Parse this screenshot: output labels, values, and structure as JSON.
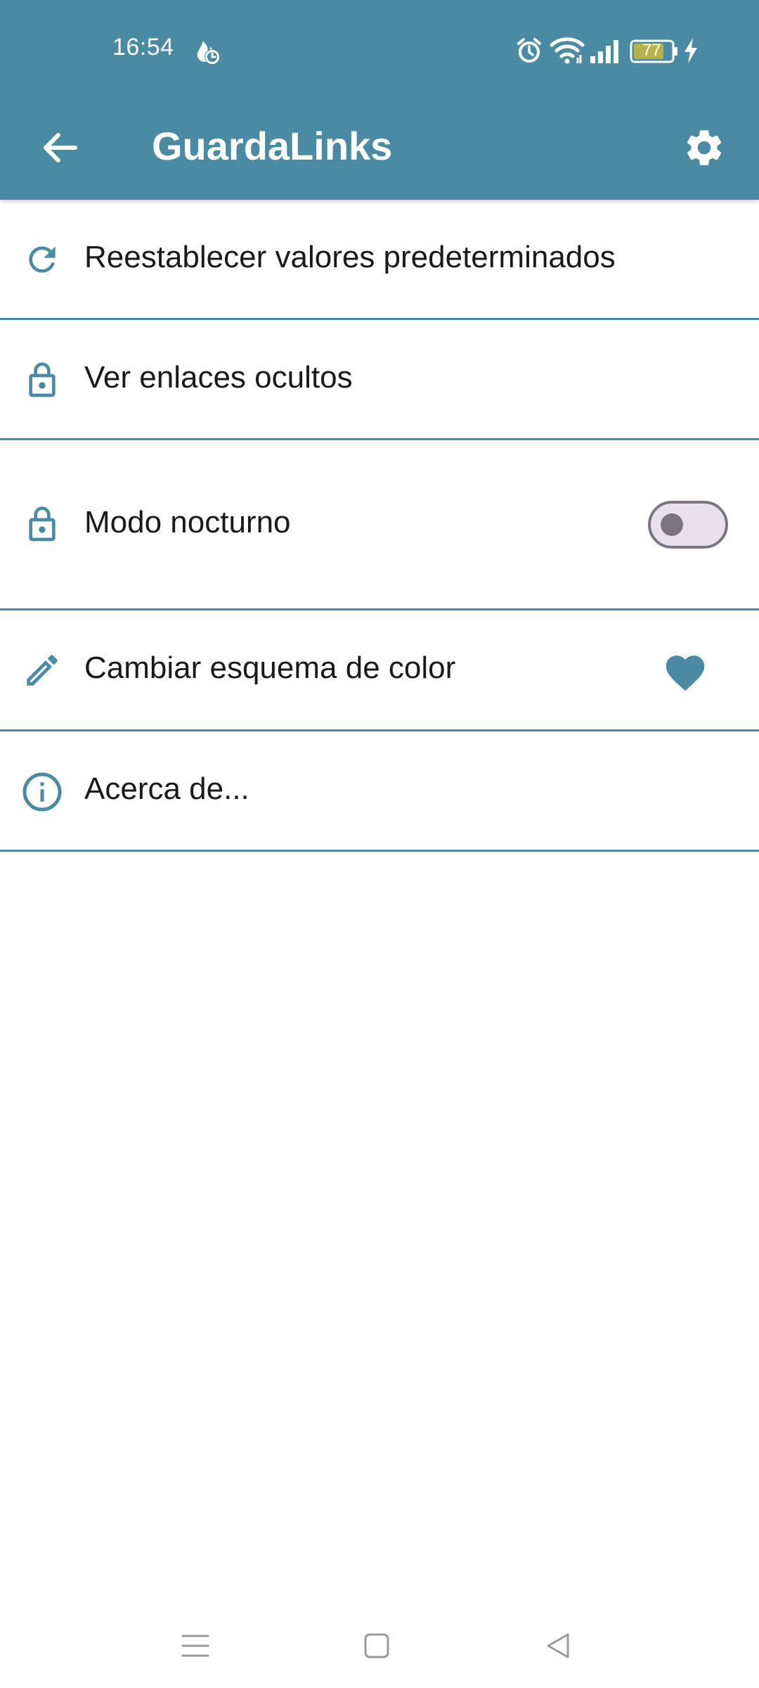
{
  "status_bar": {
    "time": "16:54",
    "battery_level": "77",
    "icons": [
      "notification-app-icon",
      "alarm-icon",
      "wifi-icon",
      "signal-icon",
      "battery-icon",
      "charging-icon"
    ]
  },
  "app_bar": {
    "title": "GuardaLinks",
    "back_icon": "arrow-left-icon",
    "settings_icon": "gear-icon"
  },
  "settings": {
    "items": [
      {
        "label": "Reestablecer valores predeterminados",
        "icon": "refresh-icon"
      },
      {
        "label": "Ver enlaces ocultos",
        "icon": "lock-icon"
      },
      {
        "label": "Modo nocturno",
        "icon": "lock-icon",
        "toggle_on": false
      },
      {
        "label": "Cambiar esquema de color",
        "icon": "pencil-icon",
        "trailing_icon": "heart-icon"
      },
      {
        "label": "Acerca de...",
        "icon": "info-icon"
      }
    ]
  },
  "nav_bar": {
    "buttons": [
      "menu-icon",
      "home-square-icon",
      "back-triangle-icon"
    ]
  },
  "colors": {
    "primary": "#4a8ba3",
    "text": "#1a1a1a",
    "toggle_track": "#e9e1ea",
    "toggle_outline": "#7a7580"
  }
}
